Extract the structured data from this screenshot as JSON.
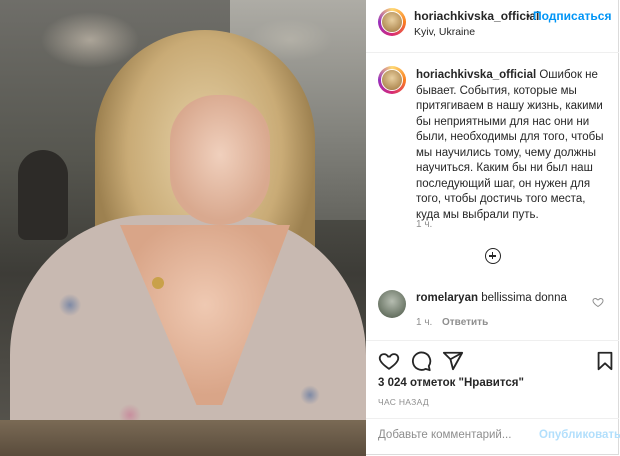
{
  "post": {
    "username": "horiachkivska_official",
    "follow_separator": "•",
    "follow_label": "Подписаться",
    "location": "Kyiv, Ukraine",
    "caption_user": "horiachkivska_official",
    "caption_text": " Ошибок не бывает. События, которые мы притягиваем в нашу жизнь, какими бы неприятными для нас они ни были, необходимы для того, чтобы мы научились тому, чему должны научиться. Каким бы ни был наш последующий шаг, он нужен для того, чтобы достичь того места, куда мы выбрали путь.",
    "caption_time": "1 ч."
  },
  "comment": {
    "user": "romelaryan",
    "text": " bellissima donna",
    "time": "1 ч.",
    "reply_label": "Ответить"
  },
  "stats": {
    "likes": "3 024 отметок \"Нравится\"",
    "posted_ago": "ЧАС НАЗАД"
  },
  "add_comment": {
    "placeholder": "Добавьте комментарий...",
    "publish_label": "Опубликовать"
  },
  "icons": {
    "like": "heart-outline-icon",
    "comment": "comment-bubble-icon",
    "share": "paper-plane-icon",
    "save": "bookmark-icon",
    "more": "plus-circle-icon"
  },
  "colors": {
    "accent": "#0095f6",
    "muted": "#8e8e8e",
    "text": "#262626"
  }
}
